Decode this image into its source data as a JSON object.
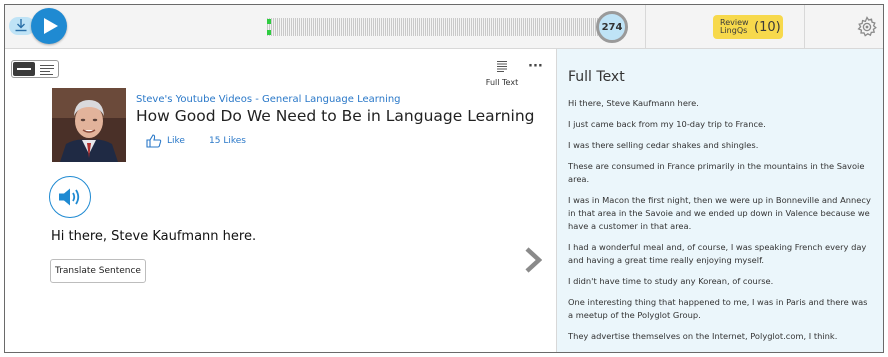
{
  "player": {
    "counter": "274"
  },
  "review": {
    "label": "Review LingQs",
    "count": "(10)"
  },
  "toolbar": {
    "full_text_label": "Full Text",
    "more_label": "···"
  },
  "lesson": {
    "course": "Steve's Youtube Videos - General Language Learning",
    "title": "How Good Do We Need to Be in Language Learning",
    "like_label": "Like",
    "likes_count": "15 Likes",
    "sentence": "Hi there, Steve Kaufmann here.",
    "translate_label": "Translate Sentence"
  },
  "panel": {
    "title": "Full Text",
    "paragraphs": [
      "Hi there, Steve Kaufmann here.",
      "I just came back from my 10-day trip to France.",
      "I was there selling cedar shakes and shingles.",
      "These are consumed in France primarily in the mountains in the Savoie area.",
      "I was in Macon the first night, then we were up in Bonneville and Annecy in that area in the Savoie and we ended up down in Valence because we have a customer in that area.",
      "I had a wonderful meal and, of course, I was speaking French every day and having a great time really enjoying myself.",
      "I didn't have time to study any Korean, of course.",
      "One interesting thing that happened to me, I was in Paris and there was a meetup of the Polyglot Group.",
      "They advertise themselves on the Internet, Polyglot.com, I think."
    ]
  },
  "colors": {
    "accent": "#1f8ad2",
    "review_badge": "#f7d94c",
    "panel_bg": "#ebf6fb",
    "link": "#2a78c8"
  },
  "icons": [
    "download-icon",
    "play-icon",
    "settings-icon",
    "full-text-icon",
    "more-icon",
    "thumbs-up-icon",
    "speaker-icon",
    "chevron-right-icon"
  ]
}
